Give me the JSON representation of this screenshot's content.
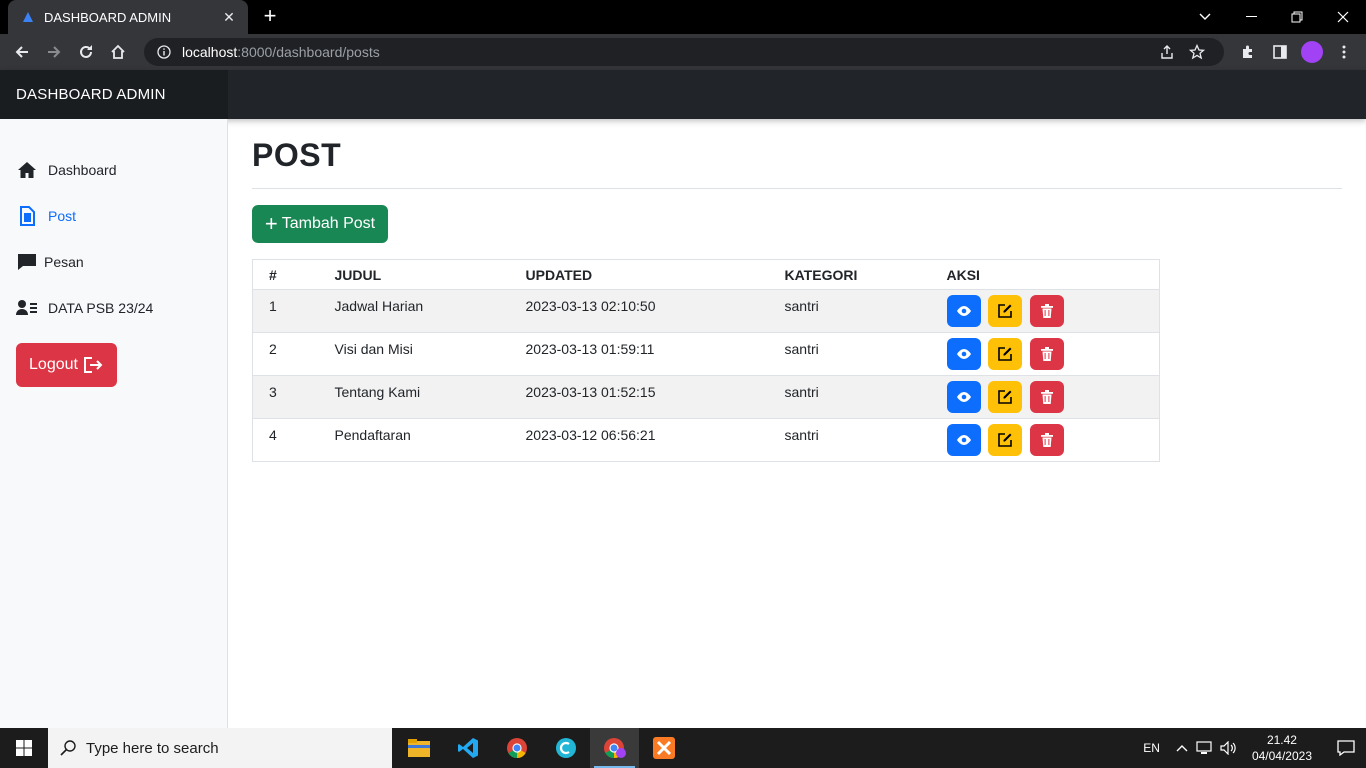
{
  "browser": {
    "tab_title": "DASHBOARD ADMIN",
    "url_host": "localhost",
    "url_rest": ":8000/dashboard/posts"
  },
  "app": {
    "brand": "DASHBOARD ADMIN"
  },
  "sidebar": {
    "items": [
      {
        "label": "Dashboard",
        "icon": "home-icon"
      },
      {
        "label": "Post",
        "icon": "file-icon",
        "active": true
      },
      {
        "label": "Pesan",
        "icon": "chat-icon"
      },
      {
        "label": "DATA PSB 23/24",
        "icon": "user-list-icon"
      }
    ],
    "logout_label": "Logout"
  },
  "main": {
    "title": "POST",
    "add_button_label": "Tambah Post",
    "table": {
      "headers": [
        "#",
        "JUDUL",
        "UPDATED",
        "KATEGORI",
        "AKSI"
      ],
      "rows": [
        {
          "no": "1",
          "judul": "Jadwal Harian",
          "updated": "2023-03-13 02:10:50",
          "kategori": "santri"
        },
        {
          "no": "2",
          "judul": "Visi dan Misi",
          "updated": "2023-03-13 01:59:11",
          "kategori": "santri"
        },
        {
          "no": "3",
          "judul": "Tentang Kami",
          "updated": "2023-03-13 01:52:15",
          "kategori": "santri"
        },
        {
          "no": "4",
          "judul": "Pendaftaran",
          "updated": "2023-03-12 06:56:21",
          "kategori": "santri"
        }
      ]
    }
  },
  "taskbar": {
    "search_placeholder": "Type here to search",
    "lang": "EN",
    "time": "21.42",
    "date": "04/04/2023"
  },
  "colors": {
    "primary": "#0d6efd",
    "success": "#198754",
    "warning": "#ffc107",
    "danger": "#dc3545",
    "topbar": "#212529"
  }
}
